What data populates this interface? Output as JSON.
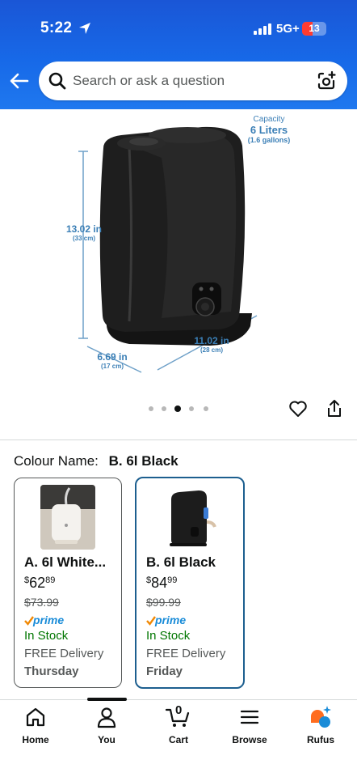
{
  "status_bar": {
    "time": "5:22",
    "network": "5G+",
    "battery": "13"
  },
  "search": {
    "placeholder": "Search or ask a question"
  },
  "product_image": {
    "capacity_label": "Capacity",
    "capacity_value": "6 Liters",
    "capacity_sub": "(1.6 gallons)",
    "height_value": "13.02 in",
    "height_sub": "(33 cm)",
    "width_value": "11.02 in",
    "width_sub": "(28 cm)",
    "depth_value": "6.69 in",
    "depth_sub": "(17 cm)",
    "slide_index": 3,
    "slide_count": 5
  },
  "colour": {
    "label": "Colour Name:",
    "value": "B. 6l Black"
  },
  "options": [
    {
      "title": "A. 6l White...",
      "price_symbol": "$",
      "price_whole": "62",
      "price_fraction": "89",
      "was_price": "$73.99",
      "prime": "prime",
      "stock": "In Stock",
      "delivery": "FREE Delivery",
      "day": "Thursday",
      "selected": false
    },
    {
      "title": "B. 6l Black",
      "price_symbol": "$",
      "price_whole": "84",
      "price_fraction": "99",
      "was_price": "$99.99",
      "prime": "prime",
      "stock": "In Stock",
      "delivery": "FREE Delivery",
      "day": "Friday",
      "selected": true
    }
  ],
  "bottom_nav": [
    {
      "label": "Home",
      "icon": "home-icon"
    },
    {
      "label": "You",
      "icon": "person-icon"
    },
    {
      "label": "Cart",
      "icon": "cart-icon",
      "count": "0"
    },
    {
      "label": "Browse",
      "icon": "menu-icon"
    },
    {
      "label": "Rufus",
      "icon": "rufus-icon"
    }
  ],
  "colors": {
    "header_blue": "#1769e8",
    "selected_border": "#1d5f8f",
    "stock_green": "#007600",
    "prime_blue": "#1a8cd8"
  }
}
